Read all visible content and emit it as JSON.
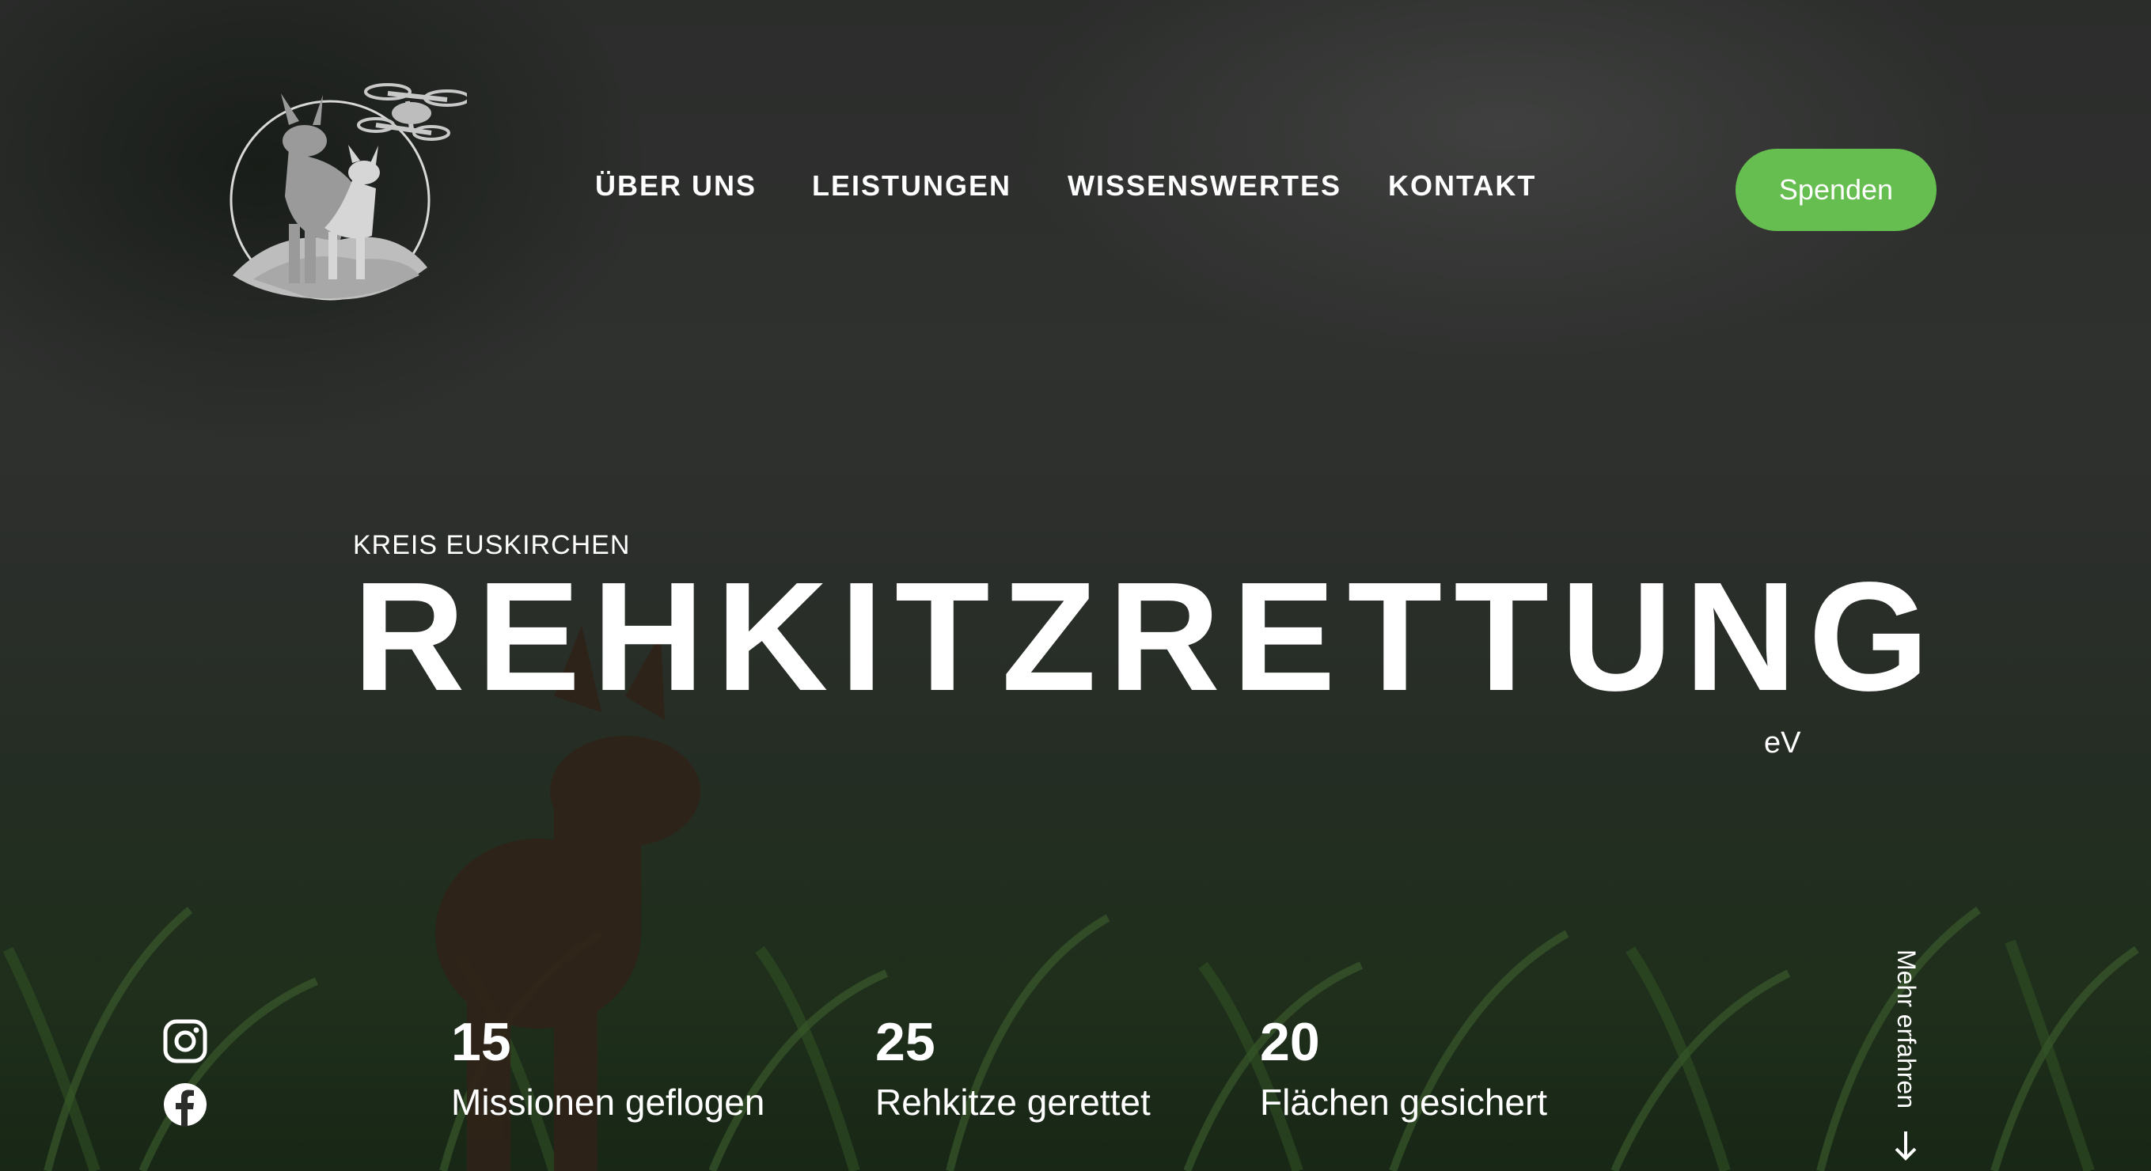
{
  "nav": {
    "items": [
      {
        "label": "ÜBER UNS"
      },
      {
        "label": "LEISTUNGEN"
      },
      {
        "label": "WISSENSWERTES"
      },
      {
        "label": "KONTAKT"
      }
    ],
    "donate_label": "Spenden"
  },
  "hero": {
    "overline": "KREIS EUSKIRCHEN",
    "title": "REHKITZRETTUNG",
    "suffix": "eV"
  },
  "social": [
    {
      "icon": "instagram-icon"
    },
    {
      "icon": "facebook-icon"
    }
  ],
  "stats": [
    {
      "value": "15",
      "label": "Missionen geflogen"
    },
    {
      "value": "25",
      "label": "Rehkitze gerettet"
    },
    {
      "value": "20",
      "label": "Flächen gesichert"
    }
  ],
  "more_label": "Mehr erfahren",
  "colors": {
    "accent": "#66bd50",
    "text": "#ffffff"
  }
}
